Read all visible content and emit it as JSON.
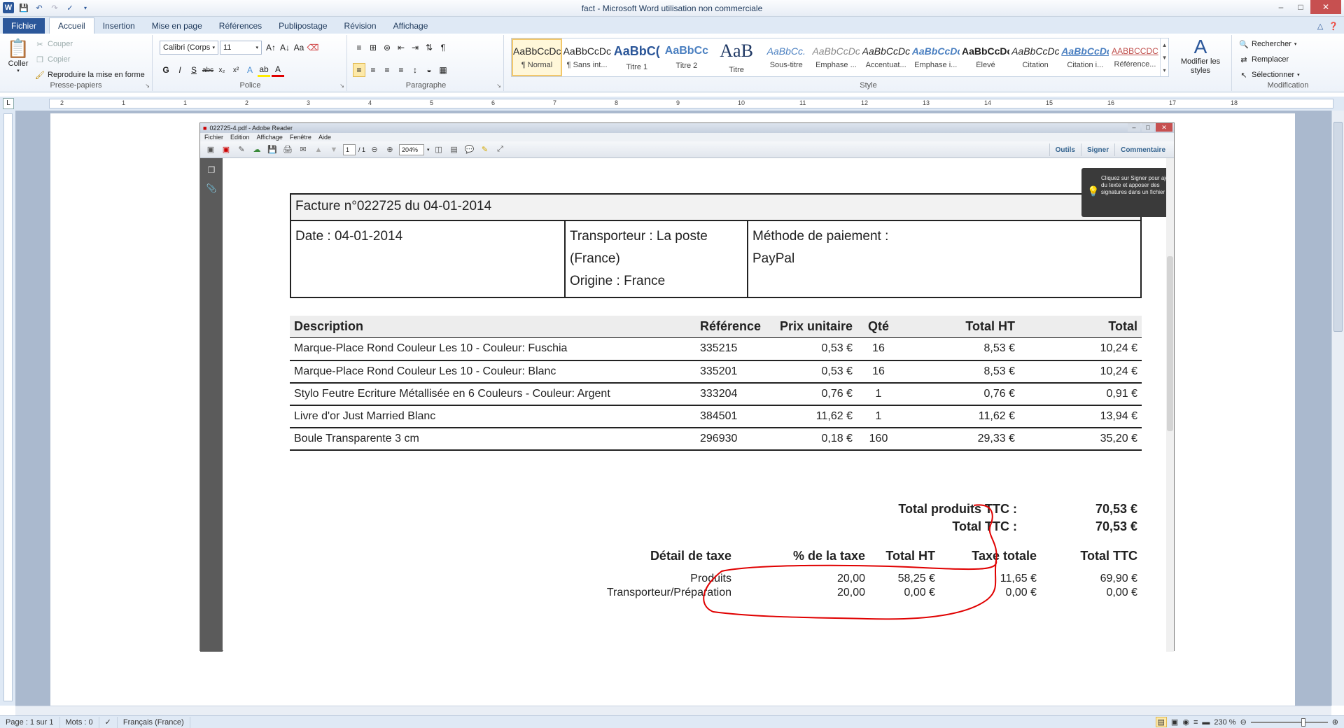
{
  "window": {
    "title": "fact  -  Microsoft Word utilisation non commerciale"
  },
  "ribbon_tabs": [
    "Fichier",
    "Accueil",
    "Insertion",
    "Mise en page",
    "Références",
    "Publipostage",
    "Révision",
    "Affichage"
  ],
  "clipboard": {
    "paste_label": "Coller",
    "cut": "Couper",
    "copy": "Copier",
    "format_painter": "Reproduire la mise en forme",
    "group_label": "Presse-papiers"
  },
  "font": {
    "family": "Calibri (Corps",
    "size": "11",
    "group_label": "Police"
  },
  "paragraph": {
    "group_label": "Paragraphe"
  },
  "styles": {
    "group_label": "Style",
    "items": [
      {
        "sample": "AaBbCcDc",
        "name": "¶ Normal"
      },
      {
        "sample": "AaBbCcDc",
        "name": "¶ Sans int..."
      },
      {
        "sample": "AaBbC(",
        "name": "Titre 1"
      },
      {
        "sample": "AaBbCc",
        "name": "Titre 2"
      },
      {
        "sample": "AaB",
        "name": "Titre"
      },
      {
        "sample": "AaBbCc.",
        "name": "Sous-titre"
      },
      {
        "sample": "AaBbCcDc",
        "name": "Emphase ..."
      },
      {
        "sample": "AaBbCcDc",
        "name": "Accentuat..."
      },
      {
        "sample": "AaBbCcDc",
        "name": "Emphase i..."
      },
      {
        "sample": "AaBbCcDc",
        "name": "Élevé"
      },
      {
        "sample": "AaBbCcDc",
        "name": "Citation"
      },
      {
        "sample": "AaBbCcDc",
        "name": "Citation i..."
      },
      {
        "sample": "AABBCCDC",
        "name": "Référence..."
      }
    ],
    "modify_label": "Modifier les styles"
  },
  "editing": {
    "find": "Rechercher",
    "replace": "Remplacer",
    "select": "Sélectionner",
    "group_label": "Modification"
  },
  "ruler_numbers": [
    "2",
    "1",
    "1",
    "2",
    "3",
    "4",
    "5",
    "6",
    "7",
    "8",
    "9",
    "10",
    "11",
    "12",
    "13",
    "14",
    "15",
    "16",
    "17",
    "18"
  ],
  "adobe": {
    "title": "022725-4.pdf - Adobe Reader",
    "menu": [
      "Fichier",
      "Edition",
      "Affichage",
      "Fenêtre",
      "Aide"
    ],
    "page_current": "1",
    "page_total": "/ 1",
    "zoom": "204%",
    "right_buttons": [
      "Outils",
      "Signer",
      "Commentaire"
    ],
    "tooltip": "Cliquez sur Signer pour ajouter du texte et apposer des signatures dans un fichier PDF."
  },
  "invoice": {
    "title": "Facture n°022725 du 04-01-2014",
    "date": "Date : 04-01-2014",
    "carrier": "Transporteur : La poste (France)",
    "origin": "Origine : France",
    "payment_label": "Méthode de paiement :",
    "payment_value": "PayPal",
    "columns": [
      "Description",
      "Référence",
      "Prix unitaire",
      "Qté",
      "Total HT",
      "Total"
    ],
    "rows": [
      [
        "Marque-Place Rond Couleur Les 10 - Couleur: Fuschia",
        "335215",
        "0,53 €",
        "16",
        "8,53 €",
        "10,24 €"
      ],
      [
        "Marque-Place Rond Couleur Les 10 - Couleur: Blanc",
        "335201",
        "0,53 €",
        "16",
        "8,53 €",
        "10,24 €"
      ],
      [
        "Stylo Feutre Ecriture Métallisée en 6 Couleurs  - Couleur: Argent",
        "333204",
        "0,76 €",
        "1",
        "0,76 €",
        "0,91 €"
      ],
      [
        "Livre d'or Just Married Blanc",
        "384501",
        "11,62 €",
        "1",
        "11,62 €",
        "13,94 €"
      ],
      [
        "Boule Transparente 3 cm",
        "296930",
        "0,18 €",
        "160",
        "29,33 €",
        "35,20 €"
      ]
    ],
    "total_products_label": "Total produits TTC :",
    "total_products_value": "70,53 €",
    "total_ttc_label": "Total TTC :",
    "total_ttc_value": "70,53 €",
    "tax": {
      "headers": [
        "Détail de taxe",
        "% de la taxe",
        "Total HT",
        "Taxe totale",
        "Total TTC"
      ],
      "rows": [
        [
          "Produits",
          "20,00",
          "58,25 €",
          "11,65 €",
          "69,90 €"
        ],
        [
          "Transporteur/Préparation",
          "20,00",
          "0,00 €",
          "0,00 €",
          "0,00 €"
        ]
      ]
    }
  },
  "statusbar": {
    "page": "Page : 1 sur 1",
    "words": "Mots : 0",
    "language": "Français (France)",
    "zoom": "230 %"
  },
  "colors": {
    "word_blue": "#2b579a",
    "annotation_red": "#e00000"
  }
}
